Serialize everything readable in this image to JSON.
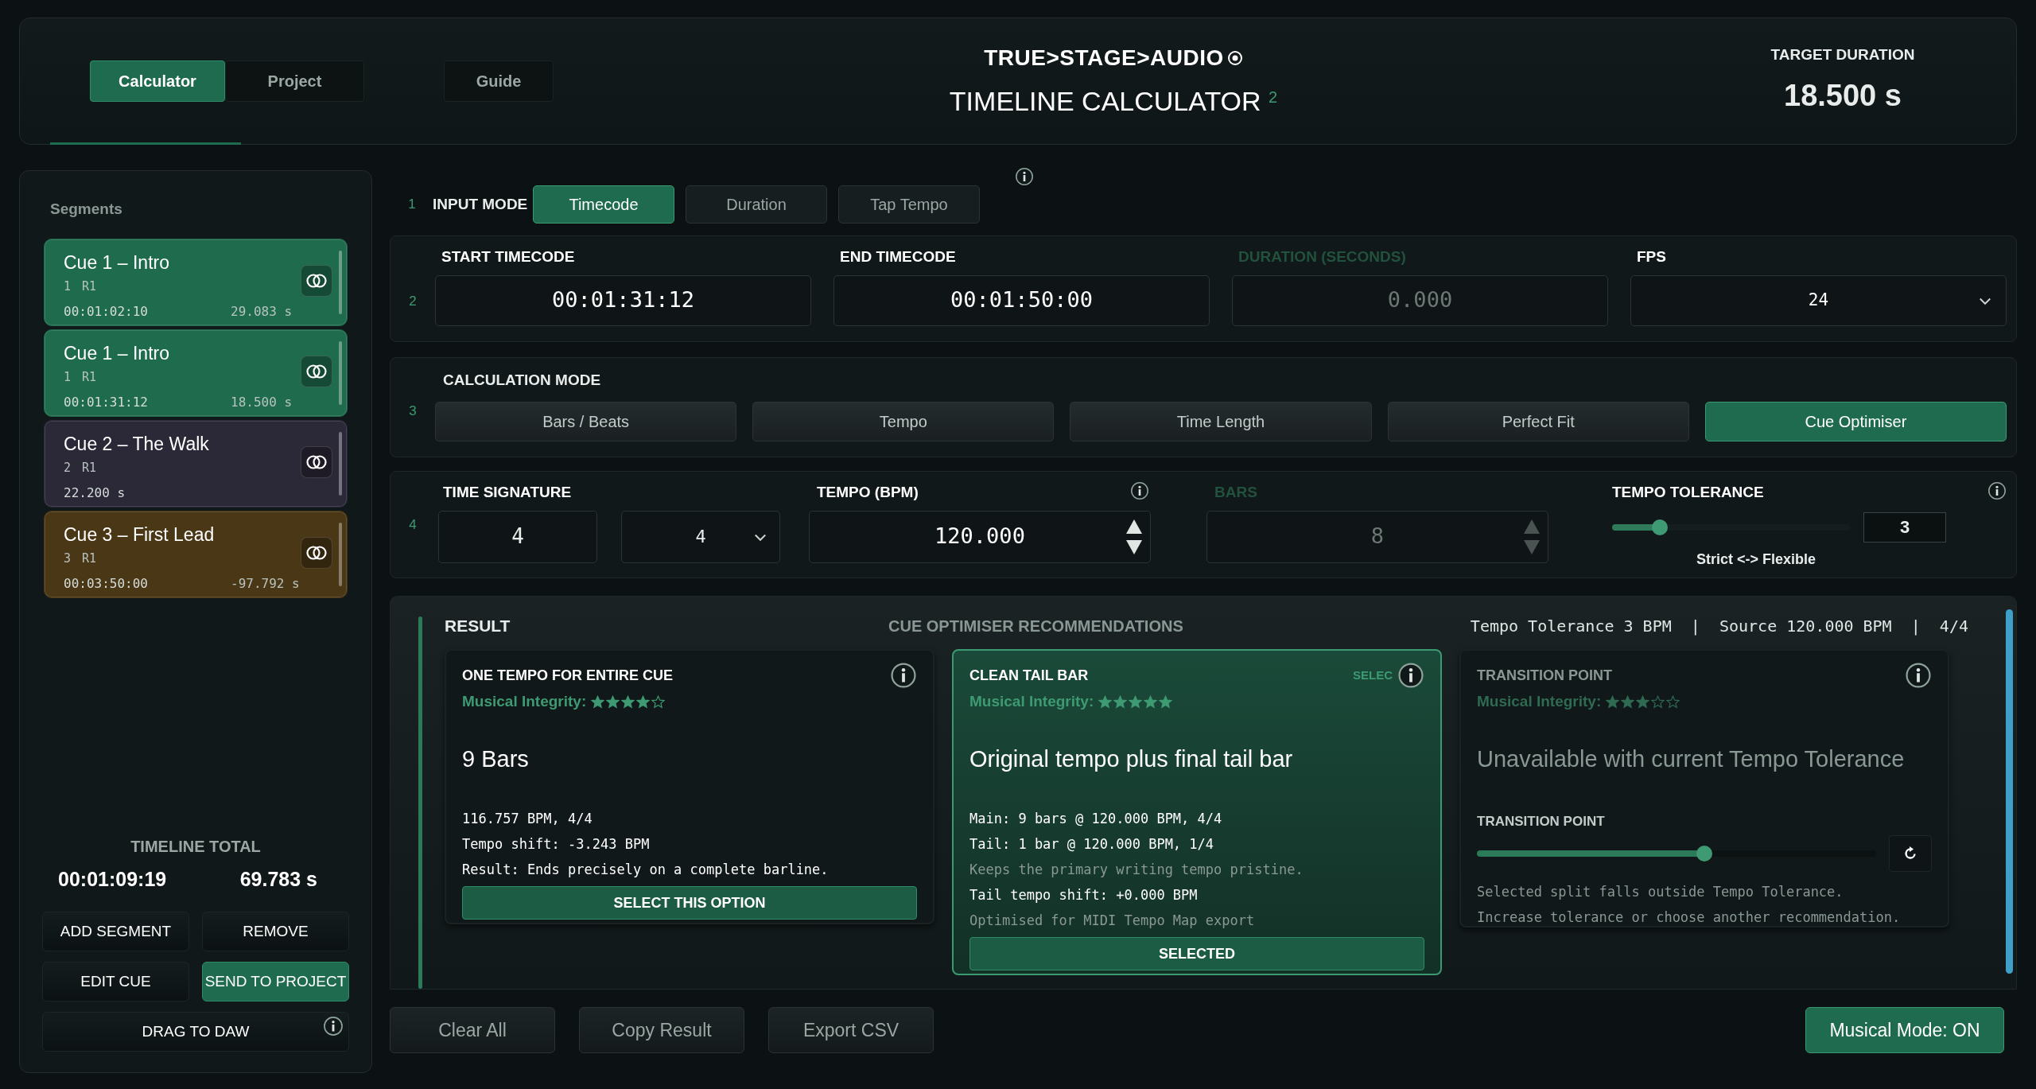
{
  "header": {
    "tabs": [
      {
        "label": "Calculator",
        "selected": true
      },
      {
        "label": "Project",
        "selected": false
      },
      {
        "label": "Guide",
        "selected": false
      }
    ],
    "logo": "TRUE>STAGE>AUDIO",
    "title": "TIMELINE CALCULATOR $^{2}$",
    "target_label": "TARGET DURATION",
    "target_value": "18.500 s"
  },
  "sidebar": {
    "heading": "Segments",
    "segments": [
      {
        "title": "Cue 1 – Intro",
        "number": "1",
        "take": "R1",
        "timecode": "00:01:02:10",
        "seconds": "29.083 s",
        "color": "#1f6b4e"
      },
      {
        "title": "Cue 1 – Intro",
        "number": "1",
        "take": "R1",
        "timecode": "00:01:31:12",
        "seconds": "18.500 s",
        "color": "#1f6b4e"
      },
      {
        "title": "Cue 2 – The Walk",
        "number": "2",
        "take": "R1",
        "seconds": "22.200 s",
        "color": "#2b2838"
      },
      {
        "title": "Cue 3 – First Lead",
        "number": "3",
        "take": "R1",
        "timecode": "00:03:50:00",
        "seconds": "-97.792 s",
        "color": "#4a3715"
      }
    ],
    "total_label": "TIMELINE TOTAL",
    "total_timecode": "00:01:09:19",
    "total_seconds": "69.783 s",
    "buttons": [
      {
        "label": "ADD SEGMENT",
        "highlighted": false,
        "wide": false,
        "info": false
      },
      {
        "label": "REMOVE",
        "highlighted": false,
        "wide": false,
        "info": false
      },
      {
        "label": "EDIT CUE",
        "highlighted": false,
        "wide": false,
        "info": false
      },
      {
        "label": "SEND TO PROJECT",
        "highlighted": true,
        "wide": false,
        "info": false
      },
      {
        "label": "DRAG TO DAW",
        "highlighted": false,
        "wide": true,
        "info": true
      }
    ]
  },
  "input_mode": {
    "number": "1",
    "label": "INPUT MODE",
    "tabs": [
      {
        "label": "Timecode",
        "selected": true
      },
      {
        "label": "Duration",
        "selected": false
      },
      {
        "label": "Tap Tempo",
        "selected": false
      }
    ]
  },
  "timing": {
    "number": "2",
    "fields": [
      {
        "label": "START TIMECODE",
        "value": "00:01:31:12",
        "kind": "text",
        "disabled": false
      },
      {
        "label": "END TIMECODE",
        "value": "00:01:50:00",
        "kind": "text",
        "disabled": false
      },
      {
        "label": "DURATION (SECONDS)",
        "value": "0.000",
        "kind": "text",
        "disabled": true
      },
      {
        "label": "FPS",
        "value": "24",
        "kind": "select",
        "disabled": false
      }
    ]
  },
  "calculation": {
    "number": "3",
    "label": "CALCULATION MODE",
    "modes": [
      {
        "label": "Bars / Beats",
        "selected": false
      },
      {
        "label": "Tempo",
        "selected": false
      },
      {
        "label": "Time Length",
        "selected": false
      },
      {
        "label": "Perfect Fit",
        "selected": false
      },
      {
        "label": "Cue Optimiser",
        "selected": true
      }
    ]
  },
  "music": {
    "number": "4",
    "time_signature": {
      "label": "TIME SIGNATURE",
      "numerator": "4",
      "denominator": "4"
    },
    "tempo": {
      "label": "TEMPO (BPM)",
      "value": "120.000"
    },
    "bars": {
      "label": "BARS",
      "value": "8",
      "disabled": true
    },
    "tolerance": {
      "label": "TEMPO TOLERANCE",
      "level": 0.2,
      "value": "3",
      "caption": "Strict <-> Flexible"
    }
  },
  "result": {
    "label": "RESULT",
    "heading": "CUE OPTIMISER RECOMMENDATIONS",
    "summary": "Tempo Tolerance 3 BPM  |  Source 120.000 BPM  |  4/4",
    "options": [
      {
        "kind": "standard",
        "title": "ONE TEMPO FOR ENTIRE CUE",
        "integrity": "Musical Integrity:",
        "stars": 4,
        "headline": "9 Bars",
        "selected": false,
        "available": true,
        "lines": [
          {
            "text": "116.757 BPM, 4/4",
            "muted": false
          },
          {
            "text": "Tempo shift: -3.243 BPM",
            "muted": false
          },
          {
            "text": "Result: Ends precisely on a complete barline.",
            "muted": false
          }
        ],
        "button": "SELECT THIS OPTION"
      },
      {
        "kind": "standard",
        "title": "CLEAN TAIL BAR",
        "badge": "SELEC",
        "integrity": "Musical Integrity:",
        "stars": 5,
        "headline": "Original tempo plus final tail bar",
        "selected": true,
        "available": true,
        "lines": [
          {
            "text": "Main: 9 bars @ 120.000 BPM, 4/4",
            "muted": false
          },
          {
            "text": "Tail: 1 bar @ 120.000 BPM, 1/4",
            "muted": false
          },
          {
            "text": "Keeps the primary writing tempo pristine.",
            "muted": true
          },
          {
            "text": "Tail tempo shift: +0.000 BPM",
            "muted": false
          },
          {
            "text": "Optimised for MIDI Tempo Map export",
            "muted": true
          }
        ],
        "button": "SELECTED"
      },
      {
        "kind": "transition",
        "title": "TRANSITION POINT",
        "integrity": "Musical Integrity:",
        "stars": 3,
        "headline": "Unavailable with current Tempo Tolerance",
        "selected": false,
        "available": false,
        "slider_label": "TRANSITION POINT",
        "level": 0.57,
        "lines": [
          {
            "text": "Selected split falls outside Tempo Tolerance.",
            "muted": true
          },
          {
            "text": "Increase tolerance or choose another recommendation.",
            "muted": true
          }
        ]
      }
    ]
  },
  "footer": {
    "buttons": [
      "Clear All",
      "Copy Result",
      "Export CSV"
    ],
    "musical_mode": "Musical Mode: ON"
  }
}
